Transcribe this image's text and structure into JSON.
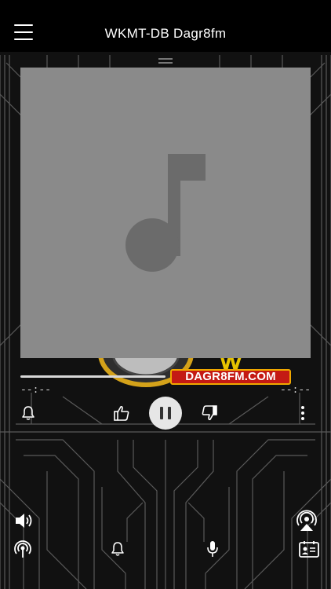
{
  "header": {
    "title": "WKMT-DB Dagr8fm",
    "menu_icon": "hamburger-menu-icon"
  },
  "artwork": {
    "placeholder_icon": "music-note-icon",
    "background_color": "#8a8a8a",
    "badge_text": "DAGR8FM.COM"
  },
  "player": {
    "elapsed": "--:--",
    "remaining": "--:--",
    "progress": 0.5,
    "state": "playing"
  },
  "controls": {
    "alarm_icon": "bell-icon",
    "like_icon": "thumbs-up-icon",
    "pause_icon": "pause-icon",
    "dislike_icon": "thumbs-down-icon",
    "more_icon": "more-vertical-icon"
  },
  "bottom_bar": {
    "volume_icon": "speaker-volume-icon",
    "airplay_icon": "airplay-icon",
    "podcast_icon": "broadcast-icon",
    "notify_icon": "bell-icon",
    "mic_icon": "microphone-icon",
    "contact_icon": "contact-card-icon"
  },
  "colors": {
    "background": "#111111",
    "header": "#000000",
    "badge_red": "#c41a14",
    "badge_gold": "#f0a800"
  }
}
